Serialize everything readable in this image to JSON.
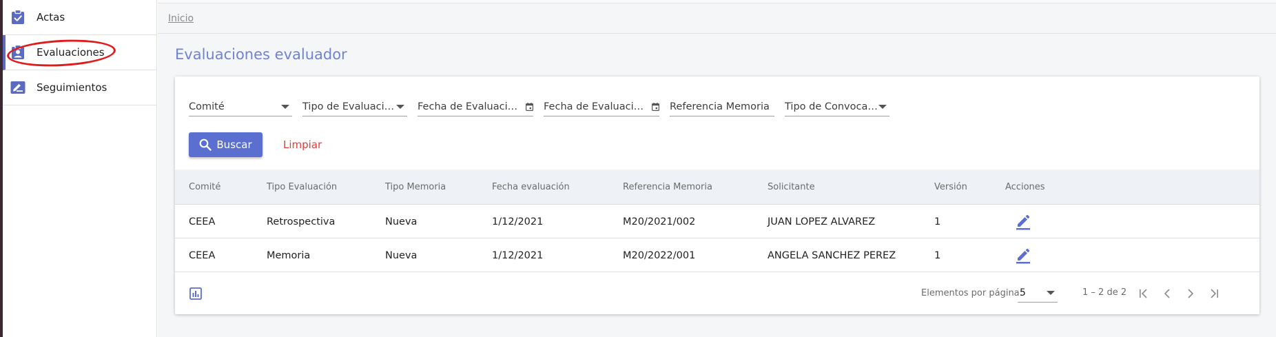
{
  "sidebar": {
    "items": [
      {
        "label": "Actas",
        "icon": "clipboard-check-icon"
      },
      {
        "label": "Evaluaciones",
        "icon": "person-badge-icon"
      },
      {
        "label": "Seguimientos",
        "icon": "edit-note-icon"
      }
    ],
    "active_index": 1
  },
  "breadcrumb": {
    "home": "Inicio"
  },
  "page": {
    "title": "Evaluaciones evaluador"
  },
  "filters": {
    "comite": "Comité",
    "tipo_evaluacion": "Tipo de Evaluación",
    "fecha_desde": "Fecha de Evaluación De...",
    "fecha_hasta": "Fecha de Evaluación Ha...",
    "referencia_memoria": "Referencia Memoria",
    "tipo_convocatoria": "Tipo de Convocatoria"
  },
  "buttons": {
    "buscar": "Buscar",
    "limpiar": "Limpiar"
  },
  "table": {
    "headers": {
      "comite": "Comité",
      "tipo_evaluacion": "Tipo Evaluación",
      "tipo_memoria": "Tipo Memoria",
      "fecha_evaluacion": "Fecha evaluación",
      "referencia_memoria": "Referencia Memoria",
      "solicitante": "Solicitante",
      "version": "Versión",
      "acciones": "Acciones"
    },
    "rows": [
      {
        "comite": "CEEA",
        "tipo_evaluacion": "Retrospectiva",
        "tipo_memoria": "Nueva",
        "fecha_evaluacion": "1/12/2021",
        "referencia_memoria": "M20/2021/002",
        "solicitante": "JUAN LOPEZ ALVAREZ",
        "version": "1"
      },
      {
        "comite": "CEEA",
        "tipo_evaluacion": "Memoria",
        "tipo_memoria": "Nueva",
        "fecha_evaluacion": "1/12/2021",
        "referencia_memoria": "M20/2022/001",
        "solicitante": "ANGELA SANCHEZ PEREZ",
        "version": "1"
      }
    ]
  },
  "paginator": {
    "items_per_page_label": "Elementos por página:",
    "items_per_page": "5",
    "range_label": "1 – 2 de 2"
  },
  "colors": {
    "primary": "#5a6fd0",
    "title": "#6f83d6",
    "danger": "#e53935",
    "annotation": "#e01b1b"
  }
}
